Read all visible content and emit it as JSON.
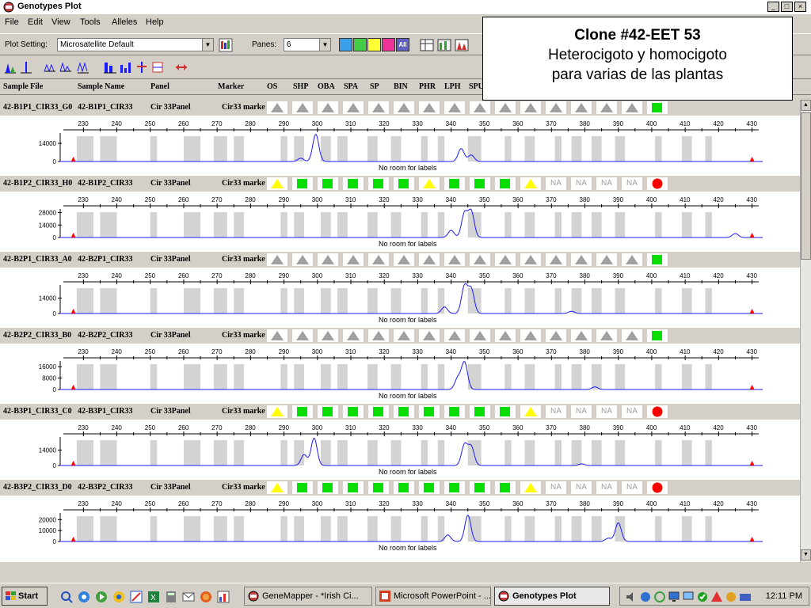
{
  "window": {
    "title": "Genotypes Plot",
    "minimize": "_",
    "maximize": "□",
    "close": "×"
  },
  "menu": [
    "File",
    "Edit",
    "View",
    "Tools",
    "Alleles",
    "Help"
  ],
  "toolbar": {
    "plot_setting_label": "Plot Setting:",
    "plot_setting_value": "Microsatellite Default",
    "panes_label": "Panes:",
    "panes_value": "6",
    "all_label": "All"
  },
  "columns": [
    "Sample File",
    "Sample Name",
    "Panel",
    "Marker",
    "OS",
    "SHP",
    "OBA",
    "SPA",
    "SP",
    "BIN",
    "PHR",
    "LPH",
    "SPU"
  ],
  "annotation": {
    "title": "Clone #42-EET 53",
    "line1": "Heterocigoto y  homocigoto",
    "line2": "para varias de las plantas"
  },
  "axis_ticks": [
    "230",
    "240",
    "250",
    "260",
    "270",
    "280",
    "290",
    "300",
    "310",
    "320",
    "330",
    "340",
    "350",
    "360",
    "370",
    "380",
    "390",
    "400",
    "410",
    "420",
    "430"
  ],
  "no_room": "No room for labels",
  "colors": {
    "trace": "#1a1aff",
    "bin": "#d3d3d3",
    "ok": "#00e000",
    "warn": "#ffff00",
    "fail": "#ff0000",
    "flag": "#a0a0a0"
  },
  "panes": [
    {
      "file": "42-B1P1_CIR33_G0",
      "name": "42-B1P1_CIR33",
      "panel": "Cir 33Panel",
      "marker": "Cir33 marke",
      "yticks": [
        "14000",
        "0"
      ],
      "ymax": 22000,
      "peaks": [
        {
          "x": 299.5,
          "h": 21000
        },
        {
          "x": 295,
          "h": 2500
        },
        {
          "x": 343,
          "h": 10000
        },
        {
          "x": 346,
          "h": 5000
        }
      ],
      "quality": [
        "tri",
        "tri",
        "tri",
        "tri",
        "tri",
        "tri",
        "tri",
        "tri",
        "tri",
        "tri",
        "tri",
        "tri",
        "tri",
        "tri",
        "tri",
        "sq"
      ]
    },
    {
      "file": "42-B1P2_CIR33_H0",
      "name": "42-B1P2_CIR33",
      "panel": "Cir 33Panel",
      "marker": "Cir33 marke",
      "yticks": [
        "28000",
        "14000",
        "0"
      ],
      "ymax": 32000,
      "peaks": [
        {
          "x": 344,
          "h": 27000
        },
        {
          "x": 346,
          "h": 29000
        },
        {
          "x": 340,
          "h": 8000
        },
        {
          "x": 425,
          "h": 4500
        }
      ],
      "quality": [
        "ytri",
        "sq",
        "sq",
        "sq",
        "sq",
        "sq",
        "ytri",
        "sq",
        "sq",
        "sq",
        "ytri",
        "NA",
        "NA",
        "NA",
        "NA",
        "circ"
      ]
    },
    {
      "file": "42-B2P1_CIR33_A0",
      "name": "42-B2P1_CIR33",
      "panel": "Cir 33Panel",
      "marker": "Cir33 marke",
      "yticks": [
        "14000",
        "0"
      ],
      "ymax": 26000,
      "peaks": [
        {
          "x": 344,
          "h": 25000
        },
        {
          "x": 346,
          "h": 22000
        },
        {
          "x": 338,
          "h": 6000
        },
        {
          "x": 376,
          "h": 2000
        }
      ],
      "quality": [
        "tri",
        "tri",
        "tri",
        "tri",
        "tri",
        "tri",
        "tri",
        "tri",
        "tri",
        "tri",
        "tri",
        "tri",
        "tri",
        "tri",
        "tri",
        "sq"
      ]
    },
    {
      "file": "42-B2P2_CIR33_B0",
      "name": "42-B2P2_CIR33",
      "panel": "Cir 33Panel",
      "marker": "Cir33 marke",
      "yticks": [
        "16000",
        "8000",
        "0"
      ],
      "ymax": 20000,
      "peaks": [
        {
          "x": 344,
          "h": 19000
        },
        {
          "x": 342,
          "h": 8000
        },
        {
          "x": 383,
          "h": 1800
        }
      ],
      "quality": [
        "tri",
        "tri",
        "tri",
        "tri",
        "tri",
        "tri",
        "tri",
        "tri",
        "tri",
        "tri",
        "tri",
        "tri",
        "tri",
        "tri",
        "tri",
        "sq"
      ]
    },
    {
      "file": "42-B3P1_CIR33_C0",
      "name": "42-B3P1_CIR33",
      "panel": "Cir 33Panel",
      "marker": "Cir33 marke",
      "yticks": [
        "14000",
        "0"
      ],
      "ymax": 26000,
      "peaks": [
        {
          "x": 299,
          "h": 25000
        },
        {
          "x": 296,
          "h": 10000
        },
        {
          "x": 344,
          "h": 19000
        },
        {
          "x": 346,
          "h": 17000
        },
        {
          "x": 379,
          "h": 1500
        }
      ],
      "quality": [
        "ytri",
        "sq",
        "sq",
        "sq",
        "sq",
        "sq",
        "sq",
        "sq",
        "sq",
        "sq",
        "ytri",
        "NA",
        "NA",
        "NA",
        "NA",
        "circ"
      ]
    },
    {
      "file": "42-B3P2_CIR33_D0",
      "name": "42-B3P2_CIR33",
      "panel": "Cir 33Panel",
      "marker": "Cir33 marke",
      "yticks": [
        "20000",
        "10000",
        "0"
      ],
      "ymax": 26000,
      "peaks": [
        {
          "x": 345,
          "h": 24000
        },
        {
          "x": 339,
          "h": 6000
        },
        {
          "x": 390,
          "h": 17000
        },
        {
          "x": 387,
          "h": 3000
        }
      ],
      "quality": [
        "ytri",
        "sq",
        "sq",
        "sq",
        "sq",
        "sq",
        "sq",
        "sq",
        "sq",
        "sq",
        "ytri",
        "NA",
        "NA",
        "NA",
        "NA",
        "circ"
      ]
    }
  ],
  "taskbar": {
    "start": "Start",
    "buttons": [
      {
        "label": "GeneMapper - *Irish  Ci...",
        "active": false
      },
      {
        "label": "Microsoft PowerPoint - ...",
        "active": false
      },
      {
        "label": "Genotypes Plot",
        "active": true
      }
    ],
    "clock": "12:11 PM"
  }
}
